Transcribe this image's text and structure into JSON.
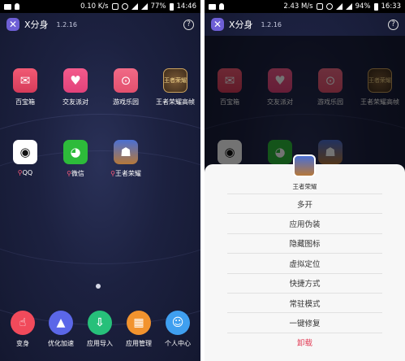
{
  "left": {
    "status": {
      "speed": "0.10 K/s",
      "battery": "77%",
      "time": "14:46"
    },
    "header": {
      "title": "X分身",
      "version": "1.2.16",
      "help": "?"
    },
    "apps": [
      {
        "label": "百宝箱",
        "icon": "treasure-box-icon",
        "glyph": "✉",
        "pinned": false
      },
      {
        "label": "交友派对",
        "icon": "party-icon",
        "glyph": "♥",
        "pinned": false
      },
      {
        "label": "游戏乐园",
        "icon": "gamepad-icon",
        "glyph": "⊙",
        "pinned": false
      },
      {
        "label": "王者荣耀高帧",
        "icon": "kog-hd-icon",
        "glyph": "王者荣耀",
        "pinned": false
      },
      {
        "label": "QQ",
        "icon": "qq-icon",
        "glyph": "◉",
        "pinned": true
      },
      {
        "label": "微信",
        "icon": "wechat-icon",
        "glyph": "◕",
        "pinned": true
      },
      {
        "label": "王者荣耀",
        "icon": "kog-icon",
        "glyph": "☗",
        "pinned": true
      }
    ],
    "dock": [
      {
        "label": "变身",
        "icon": "hand-icon",
        "glyph": "☝"
      },
      {
        "label": "优化加速",
        "icon": "rocket-icon",
        "glyph": "▲"
      },
      {
        "label": "应用导入",
        "icon": "download-icon",
        "glyph": "⇩"
      },
      {
        "label": "应用管理",
        "icon": "grid-icon",
        "glyph": "▦"
      },
      {
        "label": "个人中心",
        "icon": "person-icon",
        "glyph": "☺"
      }
    ]
  },
  "right": {
    "status": {
      "speed": "2.43 M/s",
      "battery": "94%",
      "time": "16:33"
    },
    "header": {
      "title": "X分身",
      "version": "1.2.16",
      "help": "?"
    },
    "sheet": {
      "title": "王者荣耀",
      "items": [
        "多开",
        "应用伪装",
        "隐藏图标",
        "虚拟定位",
        "快捷方式",
        "常驻模式",
        "一键修复",
        "卸载"
      ]
    }
  },
  "colors": {
    "accent": "#6e5fd6",
    "danger": "#e23b55",
    "background": "#1c2140"
  }
}
